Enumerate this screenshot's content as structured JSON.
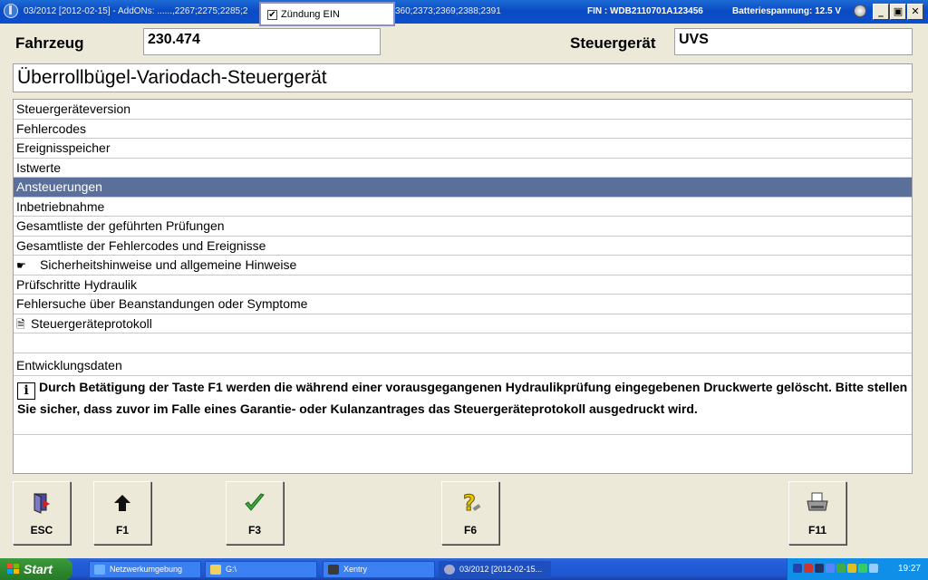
{
  "titlebar": {
    "title_left": "03/2012 [2012-02-15] - AddONs: ......,2267;2275;2285;2",
    "title_right": "360;2373;2369;2388;2391",
    "fin": "FIN : WDB2110701A123456",
    "battery": "Batteriespannung: 12.5 V",
    "minimize": "_",
    "restore": "▣",
    "close": "✕"
  },
  "popup": {
    "checked": true,
    "check_mark": "✔",
    "label": "Zündung EIN"
  },
  "header": {
    "vehicle_label": "Fahrzeug",
    "vehicle_value": "230.474",
    "ecu_label": "Steuergerät",
    "ecu_value": "UVS",
    "control_unit_name": "Überrollbügel-Variodach-Steuergerät"
  },
  "menu": {
    "items": [
      {
        "label": "Steuergeräteversion",
        "icon": ""
      },
      {
        "label": "Fehlercodes",
        "icon": ""
      },
      {
        "label": "Ereignisspeicher",
        "icon": ""
      },
      {
        "label": "Istwerte",
        "icon": ""
      },
      {
        "label": "Ansteuerungen",
        "icon": "",
        "selected": true
      },
      {
        "label": "Inbetriebnahme",
        "icon": ""
      },
      {
        "label": "Gesamtliste der geführten Prüfungen",
        "icon": ""
      },
      {
        "label": "Gesamtliste der Fehlercodes und Ereignisse",
        "icon": ""
      },
      {
        "label": "Sicherheitshinweise und allgemeine Hinweise",
        "icon": "☛"
      },
      {
        "label": "Prüfschritte Hydraulik",
        "icon": ""
      },
      {
        "label": "Fehlersuche über Beanstandungen oder Symptome",
        "icon": ""
      },
      {
        "label": "Steuergeräteprotokoll",
        "icon": "🗎"
      },
      {
        "label": "",
        "icon": ""
      },
      {
        "label": "Entwicklungsdaten",
        "icon": ""
      }
    ],
    "info_icon": "i",
    "info_text": "Durch Betätigung der Taste F1 werden die während einer vorausgegangenen Hydraulikprüfung eingegebenen Druckwerte gelöscht.  Bitte stellen Sie sicher, dass zuvor im Falle eines Garantie- oder Kulanzantrages das Steuergeräteprotokoll ausgedruckt wird."
  },
  "fkeys": [
    {
      "key": "ESC",
      "icon": "exit-door-icon",
      "glyph": "⬛"
    },
    {
      "key": "F1",
      "icon": "arrow-up-icon",
      "glyph": "⬆"
    },
    {
      "key": "F3",
      "icon": "checkmark-icon",
      "glyph": "✔"
    },
    {
      "key": "F6",
      "icon": "help-icon",
      "glyph": "?"
    },
    {
      "key": "F11",
      "icon": "printer-icon",
      "glyph": "🖶"
    }
  ],
  "taskbar": {
    "start": "Start",
    "buttons": [
      {
        "label": "Netzwerkumgebung"
      },
      {
        "label": "G:\\"
      },
      {
        "label": "Xentry"
      },
      {
        "label": "03/2012 [2012-02-15..."
      }
    ],
    "clock": "19:27"
  },
  "colors": {
    "selection": "#5a6f99",
    "titlebar": "#0c4fcc",
    "check_green": "#3aa63a",
    "help_yellow": "#e8c800"
  }
}
